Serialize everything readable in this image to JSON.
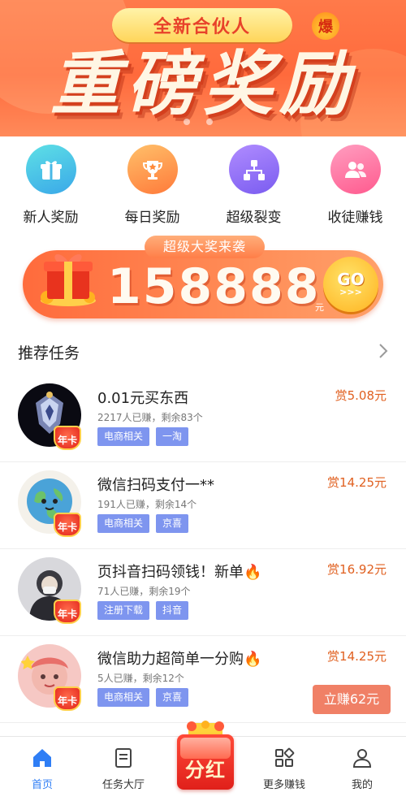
{
  "banner": {
    "pill": "全新合伙人",
    "hot": "爆",
    "title": "重磅奖励"
  },
  "quick": [
    {
      "label": "新人奖励",
      "icon": "gift-icon",
      "color": "#35c2d6"
    },
    {
      "label": "每日奖励",
      "icon": "trophy-icon",
      "color": "#ff8a3a"
    },
    {
      "label": "超级裂变",
      "icon": "network-icon",
      "color": "#8b6cf3"
    },
    {
      "label": "收徒赚钱",
      "icon": "users-icon",
      "color": "#ff6aa0"
    }
  ],
  "jackpot": {
    "tag": "超级大奖来袭",
    "amount": "158888",
    "unit": "元",
    "go": "GO",
    "arrows": ">>>"
  },
  "section": {
    "title": "推荐任务"
  },
  "tasks": [
    {
      "title": "0.01元买东西",
      "meta": "2217人已赚，剩余83个",
      "tags": [
        "电商相关",
        "一淘"
      ],
      "reward": "赏5.08元",
      "badge": "年卡"
    },
    {
      "title": "微信扫码支付一**",
      "meta": "191人已赚，剩余14个",
      "tags": [
        "电商相关",
        "京喜"
      ],
      "reward": "赏14.25元",
      "badge": "年卡"
    },
    {
      "title": "页抖音扫码领钱！新单🔥",
      "meta": "71人已赚，剩余19个",
      "tags": [
        "注册下载",
        "抖音"
      ],
      "reward": "赏16.92元",
      "badge": "年卡"
    },
    {
      "title": "微信助力超简单一分购🔥",
      "meta": "5人已赚，剩余12个",
      "tags": [
        "电商相关",
        "京喜"
      ],
      "reward": "赏14.25元",
      "badge": "年卡",
      "button": "立赚62元"
    }
  ],
  "tabbar": {
    "home": "首页",
    "tasks": "任务大厅",
    "dividend": "分红",
    "more": "更多赚钱",
    "me": "我的",
    "active_color": "#2f7ef5"
  }
}
